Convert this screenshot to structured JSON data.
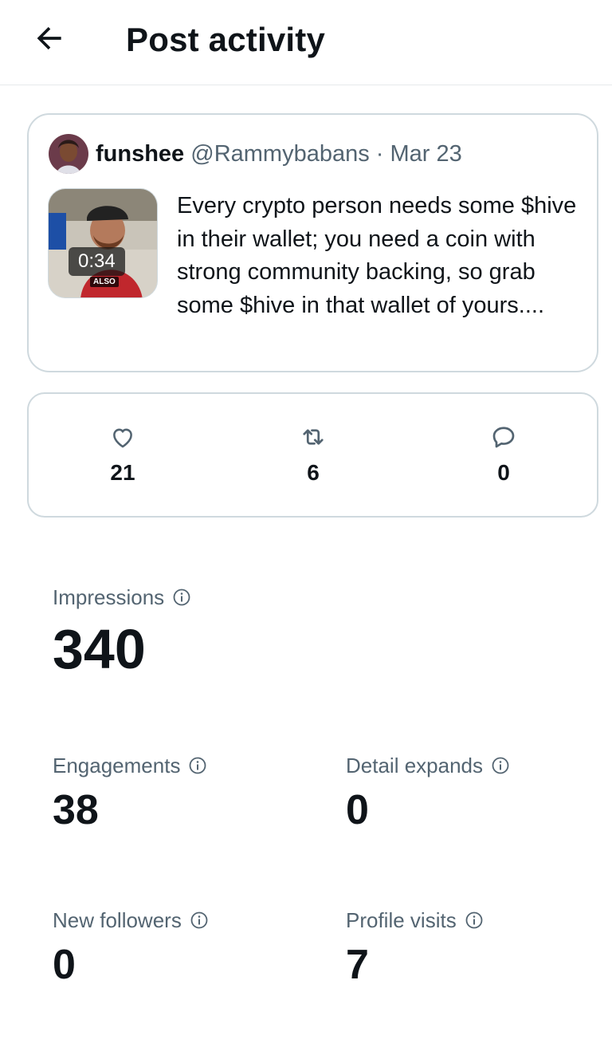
{
  "header": {
    "title": "Post activity",
    "back_icon": "arrow-left-icon"
  },
  "post": {
    "author_name": "funshee",
    "handle": "@Rammybabans",
    "separator": " · ",
    "date": "Mar 23",
    "text": "Every crypto person needs some $hive in their wallet; you need a coin with strong community backing, so grab some $hive in that wallet of yours....",
    "video_duration": "0:34",
    "thumb_tag": "ALSO"
  },
  "engagement": {
    "likes": {
      "icon": "heart-icon",
      "value": "21"
    },
    "reposts": {
      "icon": "repost-icon",
      "value": "6"
    },
    "replies": {
      "icon": "reply-icon",
      "value": "0"
    }
  },
  "stats": {
    "impressions": {
      "label": "Impressions",
      "value": "340"
    },
    "engagements": {
      "label": "Engagements",
      "value": "38"
    },
    "detail_expands": {
      "label": "Detail expands",
      "value": "0"
    },
    "new_followers": {
      "label": "New followers",
      "value": "0"
    },
    "profile_visits": {
      "label": "Profile visits",
      "value": "7"
    }
  },
  "colors": {
    "text_primary": "#0f1419",
    "text_secondary": "#536471",
    "border": "#cfd9de"
  }
}
